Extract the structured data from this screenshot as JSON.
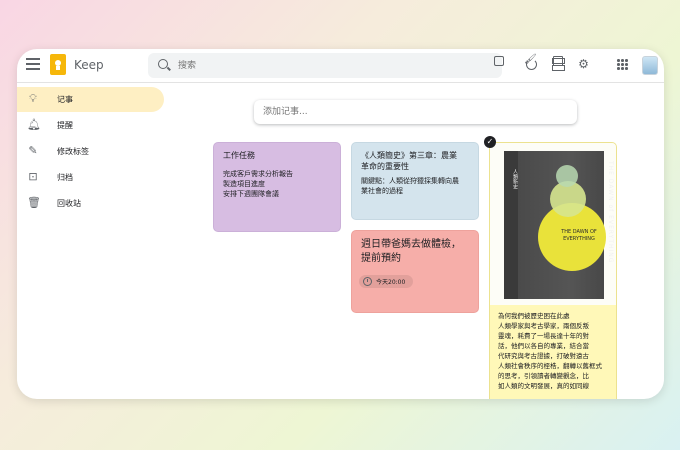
{
  "app": {
    "title": "Keep"
  },
  "search": {
    "placeholder": "搜索"
  },
  "header_icons": [
    "refresh-icon",
    "list-view-icon",
    "gear-icon",
    "apps-grid-icon",
    "avatar"
  ],
  "sidebar": {
    "items": [
      {
        "label": "记事",
        "icon": "lightbulb-icon",
        "active": true
      },
      {
        "label": "提醒",
        "icon": "bell-icon",
        "active": false
      },
      {
        "label": "修改标签",
        "icon": "pencil-icon",
        "active": false
      },
      {
        "label": "归档",
        "icon": "archive-icon",
        "active": false
      },
      {
        "label": "回收站",
        "icon": "trash-icon",
        "active": false
      }
    ]
  },
  "take_note": {
    "placeholder": "添加记事..."
  },
  "notes": {
    "purple": {
      "title": "工作任務",
      "body": "完成客戶需求分析報告\n製造項目進度\n安排下週團隊會議",
      "color": "#d7bde2"
    },
    "blue": {
      "title": "《人類簡史》第三章：農業\n革命的重要性",
      "body": "關鍵點：人類從狩獵採集轉向農\n業社會的過程",
      "color": "#d4e4ed"
    },
    "red": {
      "title": "週日帶爸媽去做體檢，\n提前預約",
      "reminder": "今天20:00",
      "color": "#f6aea9"
    },
    "yellow": {
      "book_title": "THE DAWN of EVERYTHING",
      "book_cover_text": "THE DAWN OF EVERYTHING",
      "book_cn_title": "人類新史",
      "body": "為何我們被歷史困在此處\n人類學家與考古學家，兩個反叛\n靈魂，耗費了一場長達十年的對\n話，他們以各自的專業，結合當\n代研究與考古證據，打破對遠古\n人類社會秩序的桎梏，翻轉以舊框式\n的思考，引領讀者轉變觀念，比\n如人類的文明發展，真的如同線",
      "color": "#fff8b8"
    }
  }
}
